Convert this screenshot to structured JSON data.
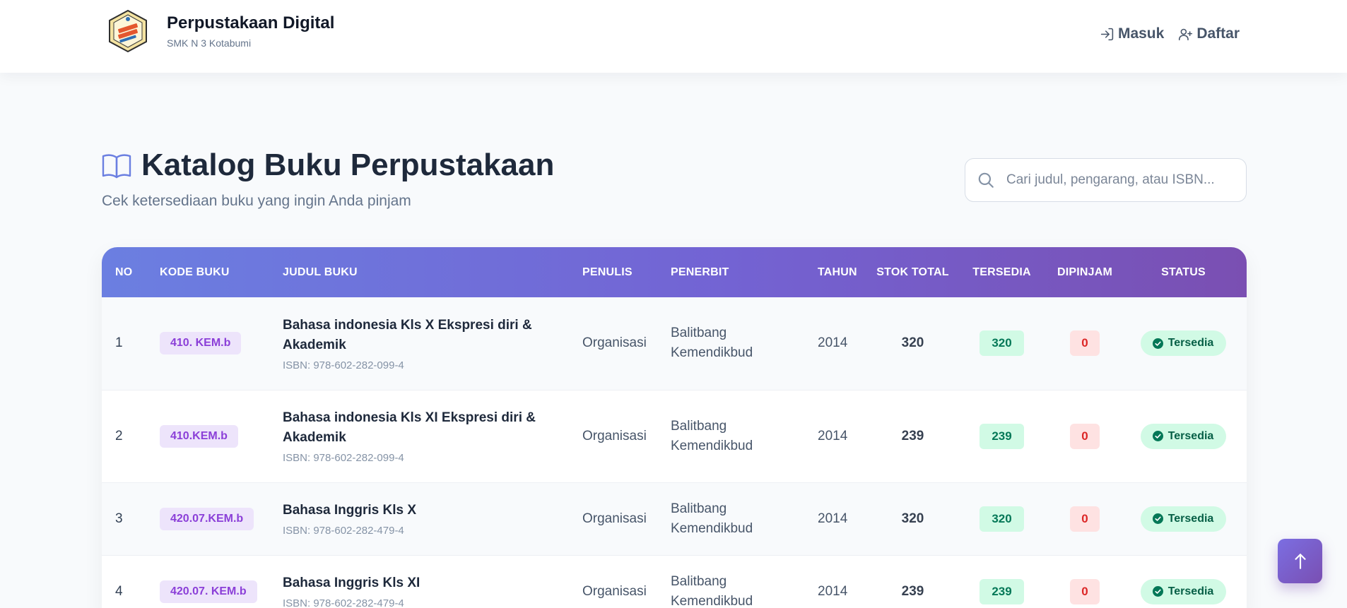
{
  "brand": {
    "title": "Perpustakaan Digital",
    "subtitle": "SMK N 3 Kotabumi"
  },
  "nav": {
    "login_label": "Masuk",
    "register_label": "Daftar"
  },
  "page": {
    "title": "Katalog Buku Perpustakaan",
    "subtitle": "Cek ketersediaan buku yang ingin Anda pinjam"
  },
  "search": {
    "placeholder": "Cari judul, pengarang, atau ISBN..."
  },
  "table": {
    "headers": {
      "no": "NO",
      "code": "KODE BUKU",
      "title": "JUDUL BUKU",
      "author": "PENULIS",
      "publisher": "PENERBIT",
      "year": "TAHUN",
      "total": "STOK TOTAL",
      "available": "TERSEDIA",
      "borrowed": "DIPINJAM",
      "status": "STATUS"
    },
    "rows": [
      {
        "no": "1",
        "code": "410. KEM.b",
        "title": "Bahasa indonesia Kls X Ekspresi diri & Akademik",
        "isbn": "ISBN: 978-602-282-099-4",
        "author": "Organisasi",
        "publisher": "Balitbang Kemendikbud",
        "year": "2014",
        "total": "320",
        "available": "320",
        "borrowed": "0",
        "status": "Tersedia"
      },
      {
        "no": "2",
        "code": "410.KEM.b",
        "title": "Bahasa indonesia Kls XI Ekspresi diri & Akademik",
        "isbn": "ISBN: 978-602-282-099-4",
        "author": "Organisasi",
        "publisher": "Balitbang Kemendikbud",
        "year": "2014",
        "total": "239",
        "available": "239",
        "borrowed": "0",
        "status": "Tersedia"
      },
      {
        "no": "3",
        "code": "420.07.KEM.b",
        "title": "Bahasa Inggris Kls X",
        "isbn": "ISBN: 978-602-282-479-4",
        "author": "Organisasi",
        "publisher": "Balitbang Kemendikbud",
        "year": "2014",
        "total": "320",
        "available": "320",
        "borrowed": "0",
        "status": "Tersedia"
      },
      {
        "no": "4",
        "code": "420.07. KEM.b",
        "title": "Bahasa Inggris Kls XI",
        "isbn": "ISBN: 978-602-282-479-4",
        "author": "Organisasi",
        "publisher": "Balitbang Kemendikbud",
        "year": "2014",
        "total": "239",
        "available": "239",
        "borrowed": "0",
        "status": "Tersedia"
      }
    ]
  },
  "colors": {
    "header_gradient_start": "#6b7fe1",
    "header_gradient_end": "#7a4fb2",
    "available_bg": "#d1fae5",
    "borrowed_bg": "#fee2e2",
    "code_color": "#8b3fd8"
  },
  "icons": {
    "login": "log-in-icon",
    "register": "user-plus-icon",
    "catalog": "open-book-icon",
    "search": "search-icon",
    "status": "check-circle-icon",
    "scroll": "arrow-up-icon"
  }
}
